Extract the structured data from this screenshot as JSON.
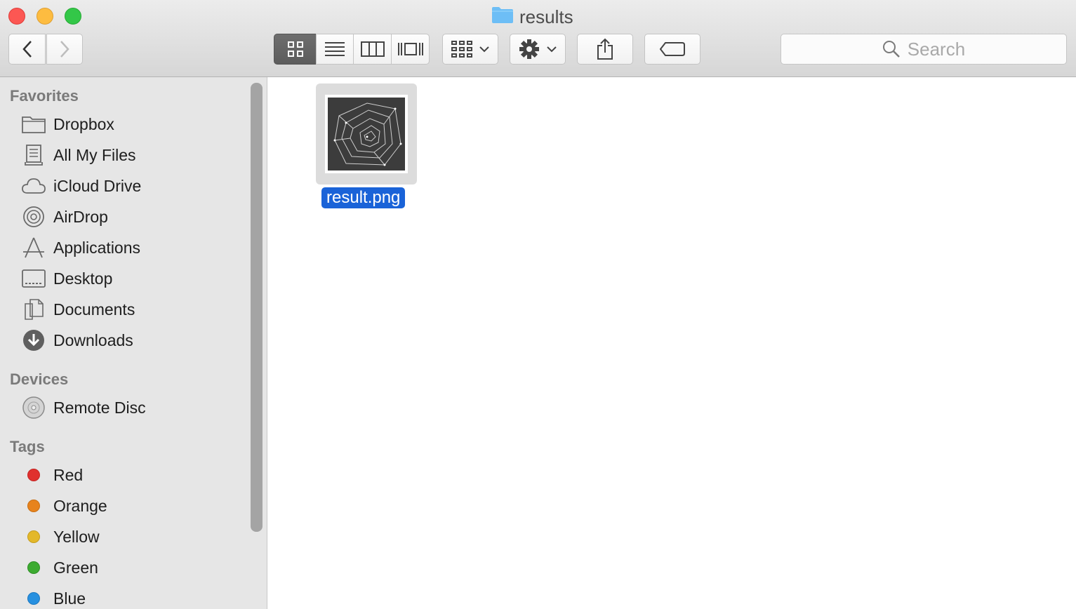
{
  "window": {
    "title": "results"
  },
  "toolbar": {
    "view_modes": [
      "icon-view",
      "list-view",
      "column-view",
      "cover-flow-view"
    ],
    "active_view": "icon-view",
    "search_placeholder": "Search"
  },
  "sidebar": {
    "favorites_heading": "Favorites",
    "favorites": [
      {
        "label": "Dropbox",
        "icon": "folder-icon"
      },
      {
        "label": "All My Files",
        "icon": "all-files-icon"
      },
      {
        "label": "iCloud Drive",
        "icon": "cloud-icon"
      },
      {
        "label": "AirDrop",
        "icon": "airdrop-icon"
      },
      {
        "label": "Applications",
        "icon": "applications-icon"
      },
      {
        "label": "Desktop",
        "icon": "desktop-icon"
      },
      {
        "label": "Documents",
        "icon": "documents-icon"
      },
      {
        "label": "Downloads",
        "icon": "downloads-icon"
      }
    ],
    "devices_heading": "Devices",
    "devices": [
      {
        "label": "Remote Disc",
        "icon": "disc-icon"
      }
    ],
    "tags_heading": "Tags",
    "tags": [
      {
        "label": "Red",
        "color": "#e0302e"
      },
      {
        "label": "Orange",
        "color": "#e7831d"
      },
      {
        "label": "Yellow",
        "color": "#e3b82a"
      },
      {
        "label": "Green",
        "color": "#3dab31"
      },
      {
        "label": "Blue",
        "color": "#2790e0"
      }
    ]
  },
  "files": [
    {
      "name": "result.png",
      "selected": true
    }
  ],
  "colors": {
    "selection": "#1a63d8",
    "folder": "#6dbef6"
  }
}
